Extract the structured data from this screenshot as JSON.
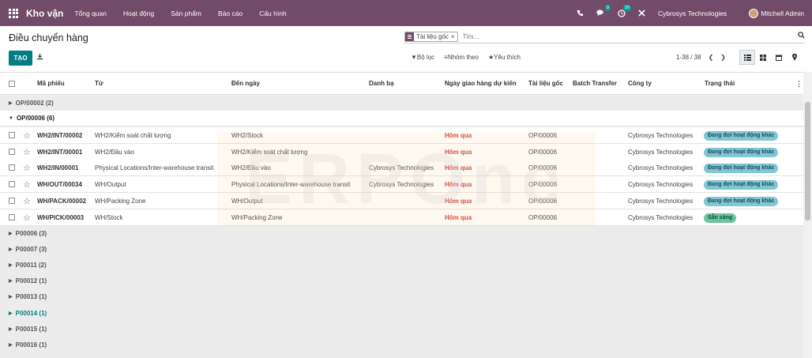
{
  "navbar": {
    "app_title": "Kho vận",
    "menu": [
      "Tổng quan",
      "Hoạt động",
      "Sản phẩm",
      "Báo cáo",
      "Cấu hình"
    ],
    "chat_badge": "9",
    "activity_badge": "29",
    "company": "Cybrosys Technologies",
    "user": "Mitchell Admin"
  },
  "control": {
    "breadcrumb": "Điều chuyển hàng",
    "facet_label": "Tài liệu gốc",
    "search_placeholder": "Tìm...",
    "create_label": "TẠO",
    "filters_label": "Bộ lọc",
    "groupby_label": "Nhóm theo",
    "favorites_label": "Yêu thích",
    "pager": "1-38 / 38"
  },
  "table": {
    "headers": [
      "Mã phiếu",
      "Từ",
      "Đến ngày",
      "Danh bạ",
      "Ngày giao hàng dự kiến",
      "Tài liệu gốc",
      "Batch Transfer",
      "Công ty",
      "Trạng thái"
    ],
    "groups_top": [
      {
        "label": "OP/00002 (2)"
      },
      {
        "label": "OP/00006 (6)"
      }
    ],
    "rows": [
      {
        "ref": "WH2/INT/00002",
        "from": "WH2/Kiểm soát chất lượng",
        "to": "WH2/Stock",
        "contact": "",
        "date": "Hôm qua",
        "origin": "OP/00006",
        "company": "Cybrosys Technologies",
        "status": "Đang đợi hoạt động khác",
        "status_type": "waiting"
      },
      {
        "ref": "WH2/INT/00001",
        "from": "WH2/Đầu vào",
        "to": "WH2/Kiểm soát chất lượng",
        "contact": "",
        "date": "Hôm qua",
        "origin": "OP/00006",
        "company": "Cybrosys Technologies",
        "status": "Đang đợi hoạt động khác",
        "status_type": "waiting"
      },
      {
        "ref": "WH2/IN/00001",
        "from": "Physical Locations/Inter-warehouse transit",
        "to": "WH2/Đầu vào",
        "contact": "Cybrosys Technologies",
        "date": "Hôm qua",
        "origin": "OP/00006",
        "company": "Cybrosys Technologies",
        "status": "Đang đợi hoạt động khác",
        "status_type": "waiting"
      },
      {
        "ref": "WH/OUT/00034",
        "from": "WH/Output",
        "to": "Physical Locations/Inter-warehouse transit",
        "contact": "Cybrosys Technologies",
        "date": "Hôm qua",
        "origin": "OP/00006",
        "company": "Cybrosys Technologies",
        "status": "Đang đợi hoạt động khác",
        "status_type": "waiting"
      },
      {
        "ref": "WH/PACK/00002",
        "from": "WH/Packing Zone",
        "to": "WH/Output",
        "contact": "",
        "date": "Hôm qua",
        "origin": "OP/00006",
        "company": "Cybrosys Technologies",
        "status": "Đang đợi hoạt động khác",
        "status_type": "waiting"
      },
      {
        "ref": "WH/PICK/00003",
        "from": "WH/Stock",
        "to": "WH/Packing Zone",
        "contact": "",
        "date": "Hôm qua",
        "origin": "OP/00006",
        "company": "Cybrosys Technologies",
        "status": "Sẵn sàng",
        "status_type": "ready"
      }
    ],
    "groups_bottom": [
      "P00006 (3)",
      "P00007 (3)",
      "P00011 (2)",
      "P00012 (1)",
      "P00013 (1)",
      "P00014 (1)",
      "P00015 (1)",
      "P00016 (1)"
    ],
    "active_group": "P00014 (1)"
  },
  "colors": {
    "brand": "#714b67",
    "accent": "#017e84",
    "overdue": "#d23f3a"
  }
}
